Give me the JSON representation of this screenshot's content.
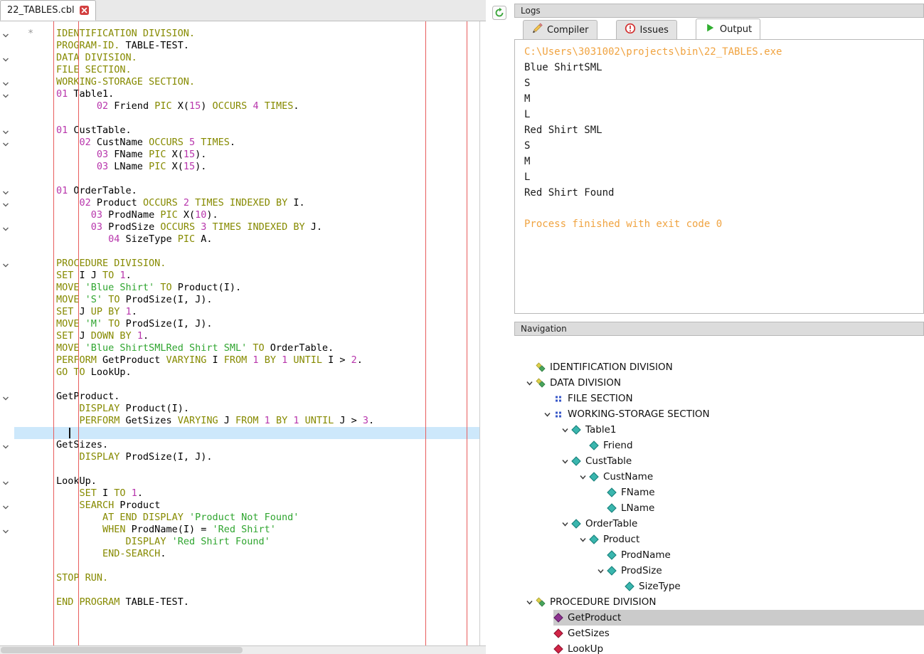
{
  "editor": {
    "tab_title": "22_TABLES.cbl",
    "marker": "*",
    "current_line": 34,
    "lines": [
      {
        "fold": true,
        "seg": [
          [
            "k",
            "IDENTIFICATION DIVISION."
          ]
        ]
      },
      {
        "fold": false,
        "seg": [
          [
            "k",
            "PROGRAM-ID."
          ],
          [
            "p",
            " TABLE-TEST."
          ]
        ]
      },
      {
        "fold": true,
        "seg": [
          [
            "k",
            "DATA DIVISION."
          ]
        ]
      },
      {
        "fold": false,
        "seg": [
          [
            "k",
            "FILE SECTION."
          ]
        ]
      },
      {
        "fold": true,
        "seg": [
          [
            "k",
            "WORKING-STORAGE SECTION."
          ]
        ]
      },
      {
        "fold": true,
        "seg": [
          [
            "n",
            "01"
          ],
          [
            "p",
            " Table1."
          ]
        ]
      },
      {
        "fold": false,
        "seg": [
          [
            "p",
            "       "
          ],
          [
            "n",
            "02"
          ],
          [
            "p",
            " Friend "
          ],
          [
            "k",
            "PIC"
          ],
          [
            "p",
            " X("
          ],
          [
            "n",
            "15"
          ],
          [
            "p",
            ") "
          ],
          [
            "k",
            "OCCURS"
          ],
          [
            "p",
            " "
          ],
          [
            "n",
            "4"
          ],
          [
            "p",
            " "
          ],
          [
            "k",
            "TIMES"
          ],
          [
            "p",
            "."
          ]
        ]
      },
      {
        "fold": false,
        "seg": []
      },
      {
        "fold": true,
        "seg": [
          [
            "n",
            "01"
          ],
          [
            "p",
            " CustTable."
          ]
        ]
      },
      {
        "fold": true,
        "seg": [
          [
            "p",
            "    "
          ],
          [
            "n",
            "02"
          ],
          [
            "p",
            " CustName "
          ],
          [
            "k",
            "OCCURS"
          ],
          [
            "p",
            " "
          ],
          [
            "n",
            "5"
          ],
          [
            "p",
            " "
          ],
          [
            "k",
            "TIMES"
          ],
          [
            "p",
            "."
          ]
        ]
      },
      {
        "fold": false,
        "seg": [
          [
            "p",
            "       "
          ],
          [
            "n",
            "03"
          ],
          [
            "p",
            " FName "
          ],
          [
            "k",
            "PIC"
          ],
          [
            "p",
            " X("
          ],
          [
            "n",
            "15"
          ],
          [
            "p",
            ")."
          ]
        ]
      },
      {
        "fold": false,
        "seg": [
          [
            "p",
            "       "
          ],
          [
            "n",
            "03"
          ],
          [
            "p",
            " LName "
          ],
          [
            "k",
            "PIC"
          ],
          [
            "p",
            " X("
          ],
          [
            "n",
            "15"
          ],
          [
            "p",
            ")."
          ]
        ]
      },
      {
        "fold": false,
        "seg": []
      },
      {
        "fold": true,
        "seg": [
          [
            "n",
            "01"
          ],
          [
            "p",
            " OrderTable."
          ]
        ]
      },
      {
        "fold": true,
        "seg": [
          [
            "p",
            "    "
          ],
          [
            "n",
            "02"
          ],
          [
            "p",
            " Product "
          ],
          [
            "k",
            "OCCURS"
          ],
          [
            "p",
            " "
          ],
          [
            "n",
            "2"
          ],
          [
            "p",
            " "
          ],
          [
            "k",
            "TIMES"
          ],
          [
            "p",
            " "
          ],
          [
            "k",
            "INDEXED BY"
          ],
          [
            "p",
            " I."
          ]
        ]
      },
      {
        "fold": false,
        "seg": [
          [
            "p",
            "      "
          ],
          [
            "n",
            "03"
          ],
          [
            "p",
            " ProdName "
          ],
          [
            "k",
            "PIC"
          ],
          [
            "p",
            " X("
          ],
          [
            "n",
            "10"
          ],
          [
            "p",
            ")."
          ]
        ]
      },
      {
        "fold": true,
        "seg": [
          [
            "p",
            "      "
          ],
          [
            "n",
            "03"
          ],
          [
            "p",
            " ProdSize "
          ],
          [
            "k",
            "OCCURS"
          ],
          [
            "p",
            " "
          ],
          [
            "n",
            "3"
          ],
          [
            "p",
            " "
          ],
          [
            "k",
            "TIMES"
          ],
          [
            "p",
            " "
          ],
          [
            "k",
            "INDEXED BY"
          ],
          [
            "p",
            " J."
          ]
        ]
      },
      {
        "fold": false,
        "seg": [
          [
            "p",
            "         "
          ],
          [
            "n",
            "04"
          ],
          [
            "p",
            " SizeType "
          ],
          [
            "k",
            "PIC"
          ],
          [
            "p",
            " A."
          ]
        ]
      },
      {
        "fold": false,
        "seg": []
      },
      {
        "fold": true,
        "seg": [
          [
            "k",
            "PROCEDURE DIVISION."
          ]
        ]
      },
      {
        "fold": false,
        "seg": [
          [
            "k",
            "SET"
          ],
          [
            "p",
            " I J "
          ],
          [
            "k",
            "TO"
          ],
          [
            "p",
            " "
          ],
          [
            "n",
            "1"
          ],
          [
            "p",
            "."
          ]
        ]
      },
      {
        "fold": false,
        "seg": [
          [
            "k",
            "MOVE"
          ],
          [
            "p",
            " "
          ],
          [
            "s",
            "'Blue Shirt'"
          ],
          [
            "p",
            " "
          ],
          [
            "k",
            "TO"
          ],
          [
            "p",
            " Product(I)."
          ]
        ]
      },
      {
        "fold": false,
        "seg": [
          [
            "k",
            "MOVE"
          ],
          [
            "p",
            " "
          ],
          [
            "s",
            "'S'"
          ],
          [
            "p",
            " "
          ],
          [
            "k",
            "TO"
          ],
          [
            "p",
            " ProdSize(I, J)."
          ]
        ]
      },
      {
        "fold": false,
        "seg": [
          [
            "k",
            "SET"
          ],
          [
            "p",
            " J "
          ],
          [
            "k",
            "UP BY"
          ],
          [
            "p",
            " "
          ],
          [
            "n",
            "1"
          ],
          [
            "p",
            "."
          ]
        ]
      },
      {
        "fold": false,
        "seg": [
          [
            "k",
            "MOVE"
          ],
          [
            "p",
            " "
          ],
          [
            "s",
            "'M'"
          ],
          [
            "p",
            " "
          ],
          [
            "k",
            "TO"
          ],
          [
            "p",
            " ProdSize(I, J)."
          ]
        ]
      },
      {
        "fold": false,
        "seg": [
          [
            "k",
            "SET"
          ],
          [
            "p",
            " J "
          ],
          [
            "k",
            "DOWN BY"
          ],
          [
            "p",
            " "
          ],
          [
            "n",
            "1"
          ],
          [
            "p",
            "."
          ]
        ]
      },
      {
        "fold": false,
        "seg": [
          [
            "k",
            "MOVE"
          ],
          [
            "p",
            " "
          ],
          [
            "s",
            "'Blue ShirtSMLRed Shirt SML'"
          ],
          [
            "p",
            " "
          ],
          [
            "k",
            "TO"
          ],
          [
            "p",
            " OrderTable."
          ]
        ]
      },
      {
        "fold": false,
        "seg": [
          [
            "k",
            "PERFORM"
          ],
          [
            "p",
            " GetProduct "
          ],
          [
            "k",
            "VARYING"
          ],
          [
            "p",
            " I "
          ],
          [
            "k",
            "FROM"
          ],
          [
            "p",
            " "
          ],
          [
            "n",
            "1"
          ],
          [
            "p",
            " "
          ],
          [
            "k",
            "BY"
          ],
          [
            "p",
            " "
          ],
          [
            "n",
            "1"
          ],
          [
            "p",
            " "
          ],
          [
            "k",
            "UNTIL"
          ],
          [
            "p",
            " I > "
          ],
          [
            "n",
            "2"
          ],
          [
            "p",
            "."
          ]
        ]
      },
      {
        "fold": false,
        "seg": [
          [
            "k",
            "GO TO"
          ],
          [
            "p",
            " LookUp."
          ]
        ]
      },
      {
        "fold": false,
        "seg": []
      },
      {
        "fold": true,
        "seg": [
          [
            "p",
            "GetProduct."
          ]
        ]
      },
      {
        "fold": false,
        "seg": [
          [
            "p",
            "    "
          ],
          [
            "k",
            "DISPLAY"
          ],
          [
            "p",
            " Product(I)."
          ]
        ]
      },
      {
        "fold": false,
        "seg": [
          [
            "p",
            "    "
          ],
          [
            "k",
            "PERFORM"
          ],
          [
            "p",
            " GetSizes "
          ],
          [
            "k",
            "VARYING"
          ],
          [
            "p",
            " J "
          ],
          [
            "k",
            "FROM"
          ],
          [
            "p",
            " "
          ],
          [
            "n",
            "1"
          ],
          [
            "p",
            " "
          ],
          [
            "k",
            "BY"
          ],
          [
            "p",
            " "
          ],
          [
            "n",
            "1"
          ],
          [
            "p",
            " "
          ],
          [
            "k",
            "UNTIL"
          ],
          [
            "p",
            " J > "
          ],
          [
            "n",
            "3"
          ],
          [
            "p",
            "."
          ]
        ]
      },
      {
        "fold": false,
        "seg": []
      },
      {
        "fold": true,
        "seg": [
          [
            "p",
            "GetSizes."
          ]
        ]
      },
      {
        "fold": false,
        "seg": [
          [
            "p",
            "    "
          ],
          [
            "k",
            "DISPLAY"
          ],
          [
            "p",
            " ProdSize(I, J)."
          ]
        ]
      },
      {
        "fold": false,
        "seg": []
      },
      {
        "fold": true,
        "seg": [
          [
            "p",
            "LookUp."
          ]
        ]
      },
      {
        "fold": false,
        "seg": [
          [
            "p",
            "    "
          ],
          [
            "k",
            "SET"
          ],
          [
            "p",
            " I "
          ],
          [
            "k",
            "TO"
          ],
          [
            "p",
            " "
          ],
          [
            "n",
            "1"
          ],
          [
            "p",
            "."
          ]
        ]
      },
      {
        "fold": true,
        "seg": [
          [
            "p",
            "    "
          ],
          [
            "k",
            "SEARCH"
          ],
          [
            "p",
            " Product"
          ]
        ]
      },
      {
        "fold": false,
        "seg": [
          [
            "p",
            "        "
          ],
          [
            "k",
            "AT END DISPLAY"
          ],
          [
            "p",
            " "
          ],
          [
            "s",
            "'Product Not Found'"
          ]
        ]
      },
      {
        "fold": true,
        "seg": [
          [
            "p",
            "        "
          ],
          [
            "k",
            "WHEN"
          ],
          [
            "p",
            " ProdName(I) = "
          ],
          [
            "s",
            "'Red Shirt'"
          ]
        ]
      },
      {
        "fold": false,
        "seg": [
          [
            "p",
            "            "
          ],
          [
            "k",
            "DISPLAY"
          ],
          [
            "p",
            " "
          ],
          [
            "s",
            "'Red Shirt Found'"
          ]
        ]
      },
      {
        "fold": false,
        "seg": [
          [
            "p",
            "        "
          ],
          [
            "k",
            "END-SEARCH"
          ],
          [
            "p",
            "."
          ]
        ]
      },
      {
        "fold": false,
        "seg": []
      },
      {
        "fold": false,
        "seg": [
          [
            "k",
            "STOP RUN."
          ]
        ]
      },
      {
        "fold": false,
        "seg": []
      },
      {
        "fold": false,
        "seg": [
          [
            "k",
            "END PROGRAM"
          ],
          [
            "p",
            " TABLE-TEST."
          ]
        ]
      }
    ]
  },
  "logs": {
    "title": "Logs",
    "tabs": [
      {
        "id": "compiler",
        "label": "Compiler",
        "icon": "pencil-icon",
        "active": false
      },
      {
        "id": "issues",
        "label": "Issues",
        "icon": "issues-icon",
        "active": false
      },
      {
        "id": "output",
        "label": "Output",
        "icon": "play-icon",
        "active": true
      }
    ],
    "console_lines": [
      {
        "text": "C:\\Users\\3031002\\projects\\bin\\22_TABLES.exe",
        "style": "orange"
      },
      {
        "text": "Blue ShirtSML",
        "style": "normal"
      },
      {
        "text": "S",
        "style": "normal"
      },
      {
        "text": "M",
        "style": "normal"
      },
      {
        "text": "L",
        "style": "normal"
      },
      {
        "text": "Red Shirt SML",
        "style": "normal"
      },
      {
        "text": "S",
        "style": "normal"
      },
      {
        "text": "M",
        "style": "normal"
      },
      {
        "text": "L",
        "style": "normal"
      },
      {
        "text": "Red Shirt Found",
        "style": "normal"
      },
      {
        "text": "",
        "style": "normal"
      },
      {
        "text": "Process finished with exit code 0",
        "style": "orange"
      }
    ]
  },
  "navigation": {
    "title": "Navigation",
    "items": [
      {
        "label": "IDENTIFICATION DIVISION",
        "level": 0,
        "icon": "division",
        "expandable": false,
        "selected": false
      },
      {
        "label": "DATA DIVISION",
        "level": 0,
        "icon": "division",
        "expandable": true,
        "selected": false
      },
      {
        "label": "FILE SECTION",
        "level": 1,
        "icon": "section",
        "expandable": false,
        "selected": false
      },
      {
        "label": "WORKING-STORAGE SECTION",
        "level": 1,
        "icon": "section",
        "expandable": true,
        "selected": false
      },
      {
        "label": "Table1",
        "level": 2,
        "icon": "variable",
        "expandable": true,
        "selected": false
      },
      {
        "label": "Friend",
        "level": 3,
        "icon": "variable",
        "expandable": false,
        "selected": false
      },
      {
        "label": "CustTable",
        "level": 2,
        "icon": "variable",
        "expandable": true,
        "selected": false
      },
      {
        "label": "CustName",
        "level": 3,
        "icon": "variable",
        "expandable": true,
        "selected": false
      },
      {
        "label": "FName",
        "level": 4,
        "icon": "variable",
        "expandable": false,
        "selected": false
      },
      {
        "label": "LName",
        "level": 4,
        "icon": "variable",
        "expandable": false,
        "selected": false
      },
      {
        "label": "OrderTable",
        "level": 2,
        "icon": "variable",
        "expandable": true,
        "selected": false
      },
      {
        "label": "Product",
        "level": 3,
        "icon": "variable",
        "expandable": true,
        "selected": false
      },
      {
        "label": "ProdName",
        "level": 4,
        "icon": "variable",
        "expandable": false,
        "selected": false
      },
      {
        "label": "ProdSize",
        "level": 4,
        "icon": "variable",
        "expandable": true,
        "selected": false
      },
      {
        "label": "SizeType",
        "level": 5,
        "icon": "variable",
        "expandable": false,
        "selected": false
      },
      {
        "label": "PROCEDURE DIVISION",
        "level": 0,
        "icon": "division",
        "expandable": true,
        "selected": false
      },
      {
        "label": "GetProduct",
        "level": 1,
        "icon": "paragraph-purple",
        "expandable": false,
        "selected": true
      },
      {
        "label": "GetSizes",
        "level": 1,
        "icon": "paragraph-red",
        "expandable": false,
        "selected": false
      },
      {
        "label": "LookUp",
        "level": 1,
        "icon": "paragraph-red",
        "expandable": false,
        "selected": false
      }
    ]
  },
  "colors": {
    "keyword": "#868a00",
    "number": "#b836ac",
    "string": "#2fa52f",
    "console_accent": "#f0a340",
    "current_line_bg": "#cde8fb",
    "margin_ruler": "#e85c5c",
    "selection_bg": "#cbcbcb"
  }
}
